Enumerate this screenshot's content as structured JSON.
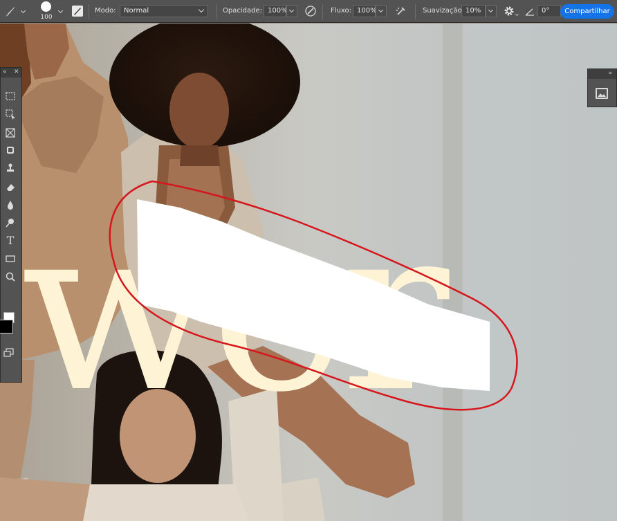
{
  "options_bar": {
    "brush_size": "100",
    "mode_label": "Modo:",
    "mode_value": "Normal",
    "opacity_label": "Opacidade:",
    "opacity_value": "100%",
    "flow_label": "Fluxo:",
    "flow_value": "100%",
    "smoothing_label": "Suavização:",
    "smoothing_value": "10%",
    "angle_value": "0°",
    "share_label": "Compartilhar"
  },
  "canvas": {
    "overlay_text": "wer",
    "overlay_color": "#fff3d6",
    "annotation_color": "#d6161c",
    "mask_color": "#ffffff"
  },
  "toolbar": {
    "tools": [
      "marquee-tool",
      "object-select-tool",
      "frame-tool",
      "healing-brush-tool",
      "clone-stamp-tool",
      "eraser-tool",
      "blur-tool",
      "dodge-tool",
      "type-tool",
      "rectangle-tool",
      "zoom-tool"
    ],
    "type_glyph": "T",
    "foreground_color": "#000000",
    "background_color": "#ffffff"
  },
  "right_panel": {
    "items": [
      "navigator-icon"
    ]
  }
}
